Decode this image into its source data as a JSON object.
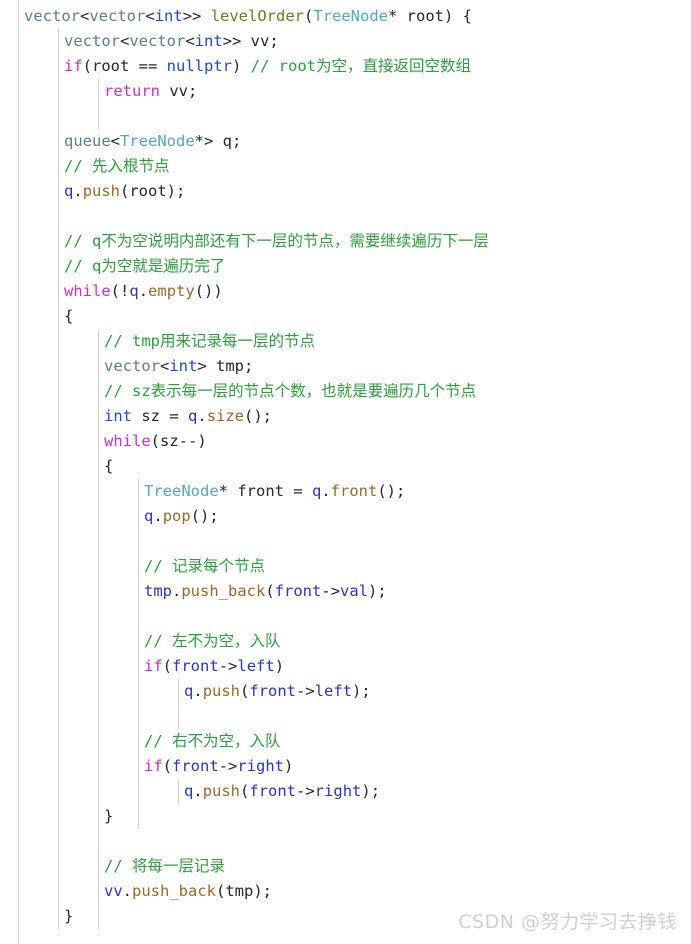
{
  "editor": {
    "language": "cpp",
    "background_color": "#ffffff",
    "gutter_rule_color": "#d7d7d7",
    "indent_guide_color": "#cfcfcf",
    "palette": {
      "type": "#5b7f95",
      "primitive": "#1a4cd6",
      "class": "#52a8c4",
      "function": "#7d7629",
      "keyword": "#c930d0",
      "method": "#9c6a28",
      "identifier": "#2b35c4",
      "comment": "#2e9e3e",
      "plain": "#24292e"
    }
  },
  "watermark": {
    "text": "CSDN @努力学习去挣钱",
    "color": "#d0d0d0"
  },
  "code": {
    "lines": [
      {
        "indent": 0,
        "guides": [],
        "tokens": [
          {
            "t": "vector",
            "c": "type"
          },
          {
            "t": "<",
            "c": "plain"
          },
          {
            "t": "vector",
            "c": "type"
          },
          {
            "t": "<",
            "c": "plain"
          },
          {
            "t": "int",
            "c": "prim"
          },
          {
            "t": ">> ",
            "c": "plain"
          },
          {
            "t": "levelOrder",
            "c": "func"
          },
          {
            "t": "(",
            "c": "plain"
          },
          {
            "t": "TreeNode",
            "c": "class"
          },
          {
            "t": "* root) {",
            "c": "plain"
          }
        ]
      },
      {
        "indent": 1,
        "guides": [
          1
        ],
        "tokens": [
          {
            "t": "vector",
            "c": "type"
          },
          {
            "t": "<",
            "c": "plain"
          },
          {
            "t": "vector",
            "c": "type"
          },
          {
            "t": "<",
            "c": "plain"
          },
          {
            "t": "int",
            "c": "prim"
          },
          {
            "t": ">> vv;",
            "c": "plain"
          }
        ]
      },
      {
        "indent": 1,
        "guides": [
          1
        ],
        "tokens": [
          {
            "t": "if",
            "c": "kw"
          },
          {
            "t": "(root == ",
            "c": "plain"
          },
          {
            "t": "nullptr",
            "c": "prim"
          },
          {
            "t": ") ",
            "c": "plain"
          },
          {
            "t": "// root为空，直接返回空数组",
            "c": "comment"
          }
        ]
      },
      {
        "indent": 2,
        "guides": [
          1,
          2
        ],
        "tokens": [
          {
            "t": "return",
            "c": "kw"
          },
          {
            "t": " vv;",
            "c": "plain"
          }
        ]
      },
      {
        "indent": 1,
        "guides": [
          1,
          2
        ],
        "tokens": []
      },
      {
        "indent": 1,
        "guides": [
          1
        ],
        "tokens": [
          {
            "t": "queue",
            "c": "type"
          },
          {
            "t": "<",
            "c": "plain"
          },
          {
            "t": "TreeNode",
            "c": "class"
          },
          {
            "t": "*> q;",
            "c": "plain"
          }
        ]
      },
      {
        "indent": 1,
        "guides": [
          1
        ],
        "tokens": [
          {
            "t": "// 先入根节点",
            "c": "comment"
          }
        ]
      },
      {
        "indent": 1,
        "guides": [
          1
        ],
        "tokens": [
          {
            "t": "q",
            "c": "ident"
          },
          {
            "t": ".",
            "c": "plain"
          },
          {
            "t": "push",
            "c": "method"
          },
          {
            "t": "(root);",
            "c": "plain"
          }
        ]
      },
      {
        "indent": 1,
        "guides": [
          1
        ],
        "tokens": []
      },
      {
        "indent": 1,
        "guides": [
          1
        ],
        "tokens": [
          {
            "t": "// q不为空说明内部还有下一层的节点，需要继续遍历下一层",
            "c": "comment"
          }
        ]
      },
      {
        "indent": 1,
        "guides": [
          1
        ],
        "tokens": [
          {
            "t": "// q为空就是遍历完了",
            "c": "comment"
          }
        ]
      },
      {
        "indent": 1,
        "guides": [
          1
        ],
        "tokens": [
          {
            "t": "while",
            "c": "kw"
          },
          {
            "t": "(!",
            "c": "plain"
          },
          {
            "t": "q",
            "c": "ident"
          },
          {
            "t": ".",
            "c": "plain"
          },
          {
            "t": "empty",
            "c": "method"
          },
          {
            "t": "())",
            "c": "plain"
          }
        ]
      },
      {
        "indent": 1,
        "guides": [
          1
        ],
        "tokens": [
          {
            "t": "{",
            "c": "plain"
          }
        ]
      },
      {
        "indent": 2,
        "guides": [
          1,
          2
        ],
        "tokens": [
          {
            "t": "// tmp用来记录每一层的节点",
            "c": "comment"
          }
        ]
      },
      {
        "indent": 2,
        "guides": [
          1,
          2
        ],
        "tokens": [
          {
            "t": "vector",
            "c": "type"
          },
          {
            "t": "<",
            "c": "plain"
          },
          {
            "t": "int",
            "c": "prim"
          },
          {
            "t": "> tmp;",
            "c": "plain"
          }
        ]
      },
      {
        "indent": 2,
        "guides": [
          1,
          2
        ],
        "tokens": [
          {
            "t": "// sz表示每一层的节点个数，也就是要遍历几个节点",
            "c": "comment"
          }
        ]
      },
      {
        "indent": 2,
        "guides": [
          1,
          2
        ],
        "tokens": [
          {
            "t": "int",
            "c": "prim"
          },
          {
            "t": " sz = ",
            "c": "plain"
          },
          {
            "t": "q",
            "c": "ident"
          },
          {
            "t": ".",
            "c": "plain"
          },
          {
            "t": "size",
            "c": "method"
          },
          {
            "t": "();",
            "c": "plain"
          }
        ]
      },
      {
        "indent": 2,
        "guides": [
          1,
          2
        ],
        "tokens": [
          {
            "t": "while",
            "c": "kw"
          },
          {
            "t": "(sz--)",
            "c": "plain"
          }
        ]
      },
      {
        "indent": 2,
        "guides": [
          1,
          2
        ],
        "tokens": [
          {
            "t": "{",
            "c": "plain"
          }
        ]
      },
      {
        "indent": 3,
        "guides": [
          1,
          2,
          3
        ],
        "tokens": [
          {
            "t": "TreeNode",
            "c": "class"
          },
          {
            "t": "* front = ",
            "c": "plain"
          },
          {
            "t": "q",
            "c": "ident"
          },
          {
            "t": ".",
            "c": "plain"
          },
          {
            "t": "front",
            "c": "method"
          },
          {
            "t": "();",
            "c": "plain"
          }
        ]
      },
      {
        "indent": 3,
        "guides": [
          1,
          2,
          3
        ],
        "tokens": [
          {
            "t": "q",
            "c": "ident"
          },
          {
            "t": ".",
            "c": "plain"
          },
          {
            "t": "pop",
            "c": "method"
          },
          {
            "t": "();",
            "c": "plain"
          }
        ]
      },
      {
        "indent": 3,
        "guides": [
          1,
          2,
          3
        ],
        "tokens": []
      },
      {
        "indent": 3,
        "guides": [
          1,
          2,
          3
        ],
        "tokens": [
          {
            "t": "// 记录每个节点",
            "c": "comment"
          }
        ]
      },
      {
        "indent": 3,
        "guides": [
          1,
          2,
          3
        ],
        "tokens": [
          {
            "t": "tmp",
            "c": "ident"
          },
          {
            "t": ".",
            "c": "plain"
          },
          {
            "t": "push_back",
            "c": "method"
          },
          {
            "t": "(",
            "c": "plain"
          },
          {
            "t": "front",
            "c": "ident"
          },
          {
            "t": "->",
            "c": "plain"
          },
          {
            "t": "val",
            "c": "ident"
          },
          {
            "t": ");",
            "c": "plain"
          }
        ]
      },
      {
        "indent": 3,
        "guides": [
          1,
          2,
          3
        ],
        "tokens": []
      },
      {
        "indent": 3,
        "guides": [
          1,
          2,
          3
        ],
        "tokens": [
          {
            "t": "// 左不为空，入队",
            "c": "comment"
          }
        ]
      },
      {
        "indent": 3,
        "guides": [
          1,
          2,
          3
        ],
        "tokens": [
          {
            "t": "if",
            "c": "kw"
          },
          {
            "t": "(",
            "c": "plain"
          },
          {
            "t": "front",
            "c": "ident"
          },
          {
            "t": "->",
            "c": "plain"
          },
          {
            "t": "left",
            "c": "ident"
          },
          {
            "t": ")",
            "c": "plain"
          }
        ]
      },
      {
        "indent": 4,
        "guides": [
          1,
          2,
          3,
          4
        ],
        "tokens": [
          {
            "t": "q",
            "c": "ident"
          },
          {
            "t": ".",
            "c": "plain"
          },
          {
            "t": "push",
            "c": "method"
          },
          {
            "t": "(",
            "c": "plain"
          },
          {
            "t": "front",
            "c": "ident"
          },
          {
            "t": "->",
            "c": "plain"
          },
          {
            "t": "left",
            "c": "ident"
          },
          {
            "t": ");",
            "c": "plain"
          }
        ]
      },
      {
        "indent": 3,
        "guides": [
          1,
          2,
          3,
          4
        ],
        "tokens": []
      },
      {
        "indent": 3,
        "guides": [
          1,
          2,
          3
        ],
        "tokens": [
          {
            "t": "// 右不为空，入队",
            "c": "comment"
          }
        ]
      },
      {
        "indent": 3,
        "guides": [
          1,
          2,
          3
        ],
        "tokens": [
          {
            "t": "if",
            "c": "kw"
          },
          {
            "t": "(",
            "c": "plain"
          },
          {
            "t": "front",
            "c": "ident"
          },
          {
            "t": "->",
            "c": "plain"
          },
          {
            "t": "right",
            "c": "ident"
          },
          {
            "t": ")",
            "c": "plain"
          }
        ]
      },
      {
        "indent": 4,
        "guides": [
          1,
          2,
          3,
          4
        ],
        "tokens": [
          {
            "t": "q",
            "c": "ident"
          },
          {
            "t": ".",
            "c": "plain"
          },
          {
            "t": "push",
            "c": "method"
          },
          {
            "t": "(",
            "c": "plain"
          },
          {
            "t": "front",
            "c": "ident"
          },
          {
            "t": "->",
            "c": "plain"
          },
          {
            "t": "right",
            "c": "ident"
          },
          {
            "t": ");",
            "c": "plain"
          }
        ]
      },
      {
        "indent": 2,
        "guides": [
          1,
          2,
          3
        ],
        "tokens": [
          {
            "t": "}",
            "c": "plain"
          }
        ]
      },
      {
        "indent": 2,
        "guides": [
          1,
          2
        ],
        "tokens": []
      },
      {
        "indent": 2,
        "guides": [
          1,
          2
        ],
        "tokens": [
          {
            "t": "// 将每一层记录",
            "c": "comment"
          }
        ]
      },
      {
        "indent": 2,
        "guides": [
          1,
          2
        ],
        "tokens": [
          {
            "t": "vv",
            "c": "ident"
          },
          {
            "t": ".",
            "c": "plain"
          },
          {
            "t": "push_back",
            "c": "method"
          },
          {
            "t": "(tmp);",
            "c": "plain"
          }
        ]
      },
      {
        "indent": 1,
        "guides": [
          1,
          2
        ],
        "tokens": [
          {
            "t": "}",
            "c": "plain"
          }
        ]
      }
    ]
  }
}
